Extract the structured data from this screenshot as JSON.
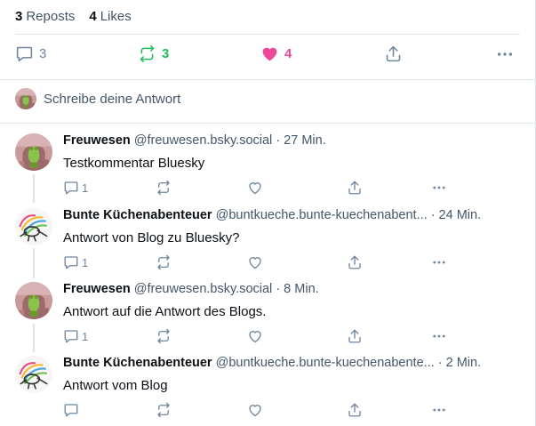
{
  "stats": {
    "reposts_count": "3",
    "reposts_label": "Reposts",
    "likes_count": "4",
    "likes_label": "Likes"
  },
  "actions": {
    "reply_count": "3",
    "repost_count": "3",
    "like_count": "4"
  },
  "reply_box": {
    "placeholder": "Schreibe deine Antwort"
  },
  "colors": {
    "repost_active": "#20bc5c",
    "like_active": "#ec4899",
    "muted": "#6f869f"
  },
  "comments": [
    {
      "author": "Freuwesen",
      "handle": "@freuwesen.bsky.social",
      "time": "· 27 Min.",
      "text": "Testkommentar Bluesky",
      "reply_count": "1"
    },
    {
      "author": "Bunte Küchenabenteuer",
      "handle": "@buntkueche.bunte-kuechenabent...",
      "time": "· 24 Min.",
      "text": "Antwort von Blog zu Bluesky?",
      "reply_count": "1"
    },
    {
      "author": "Freuwesen",
      "handle": "@freuwesen.bsky.social",
      "time": "· 8 Min.",
      "text": "Antwort auf die Antwort des Blogs.",
      "reply_count": "1"
    },
    {
      "author": "Bunte Küchenabenteuer",
      "handle": "@buntkueche.bunte-kuechenabente...",
      "time": "· 2 Min.",
      "text": "Antwort vom Blog",
      "reply_count": ""
    }
  ]
}
